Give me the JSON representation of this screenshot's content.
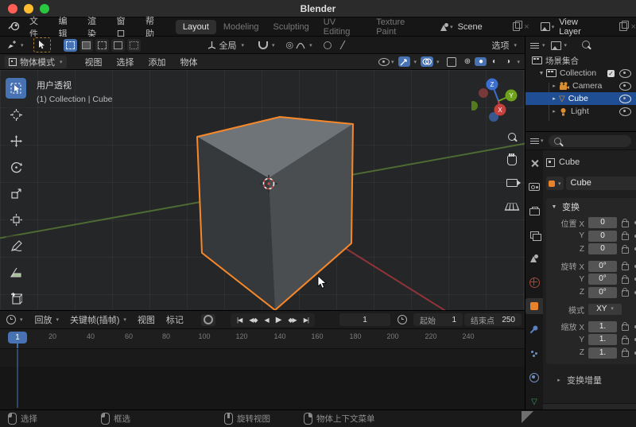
{
  "titlebar": {
    "title": "Blender"
  },
  "topbar": {
    "menus": [
      "文件",
      "编辑",
      "渲染",
      "窗口",
      "帮助"
    ],
    "workspaces": [
      "Layout",
      "Modeling",
      "Sculpting",
      "UV Editing",
      "Texture Paint"
    ],
    "scene_label": "Scene",
    "view_layer_label": "View Layer"
  },
  "tool_settings": {
    "orientation_label": "全局",
    "options_label": "选项"
  },
  "viewport": {
    "mode_label": "物体模式",
    "menus": [
      "视图",
      "选择",
      "添加",
      "物体"
    ],
    "view_name": "用户透视",
    "context_info": "(1) Collection | Cube",
    "axis": {
      "x": "X",
      "y": "Y",
      "z": "Z"
    }
  },
  "outliner": {
    "scene_collection": "场景集合",
    "collection": "Collection",
    "camera": "Camera",
    "cube": "Cube",
    "light": "Light"
  },
  "properties": {
    "breadcrumb": "Cube",
    "object_name": "Cube",
    "transform_title": "变换",
    "rows": {
      "loc_x_label": "位置 X",
      "loc_y_label": "Y",
      "loc_z_label": "Z",
      "loc_x": "0",
      "loc_y": "0",
      "loc_z": "0",
      "rot_x_label": "旋转 X",
      "rot_y_label": "Y",
      "rot_z_label": "Z",
      "rot_x": "0°",
      "rot_y": "0°",
      "rot_z": "0°",
      "mode_label": "模式",
      "mode_value": "XY",
      "scale_x_label": "缩放 X",
      "scale_y_label": "Y",
      "scale_z_label": "Z",
      "scale_x": "1.",
      "scale_y": "1.",
      "scale_z": "1."
    },
    "delta_transform_label": "变换增量"
  },
  "timeline": {
    "playback_label": "回放",
    "keying_label": "关键帧(插帧)",
    "view_label": "视图",
    "marker_label": "标记",
    "current_frame": "1",
    "start_label": "起始",
    "start_value": "1",
    "end_label": "结束点",
    "end_value": "250",
    "ticks": [
      "20",
      "40",
      "60",
      "80",
      "100",
      "120",
      "140",
      "160",
      "180",
      "200",
      "220",
      "240"
    ],
    "playhead_label": "1"
  },
  "statusbar": {
    "select_label": "选择",
    "box_select_label": "框选",
    "rotate_view_label": "旋转视图",
    "context_menu_label": "物体上下文菜单"
  },
  "glyphs": {
    "chevron": "▾",
    "collapse_open": "▼",
    "collapse_closed": "▸",
    "jump_start": "|◀",
    "prev_key": "◀◆",
    "play_back": "◀",
    "play": "▶",
    "next_key": "◆▶",
    "jump_end": "▶|",
    "check": "✓",
    "close": "×",
    "wire": "⊕",
    "solid": "●",
    "material": "◐",
    "rendered": "◑",
    "prop_edit": "◎",
    "cube_tri": "▽",
    "annotate": "✎",
    "rotate_tool": "↻",
    "move_tool": "✚",
    "measure_tool": "∡",
    "add_cube_tool": "⊞",
    "scale_tool": "◱",
    "transform_tool": "◉",
    "cursor_tool": "⊕"
  }
}
